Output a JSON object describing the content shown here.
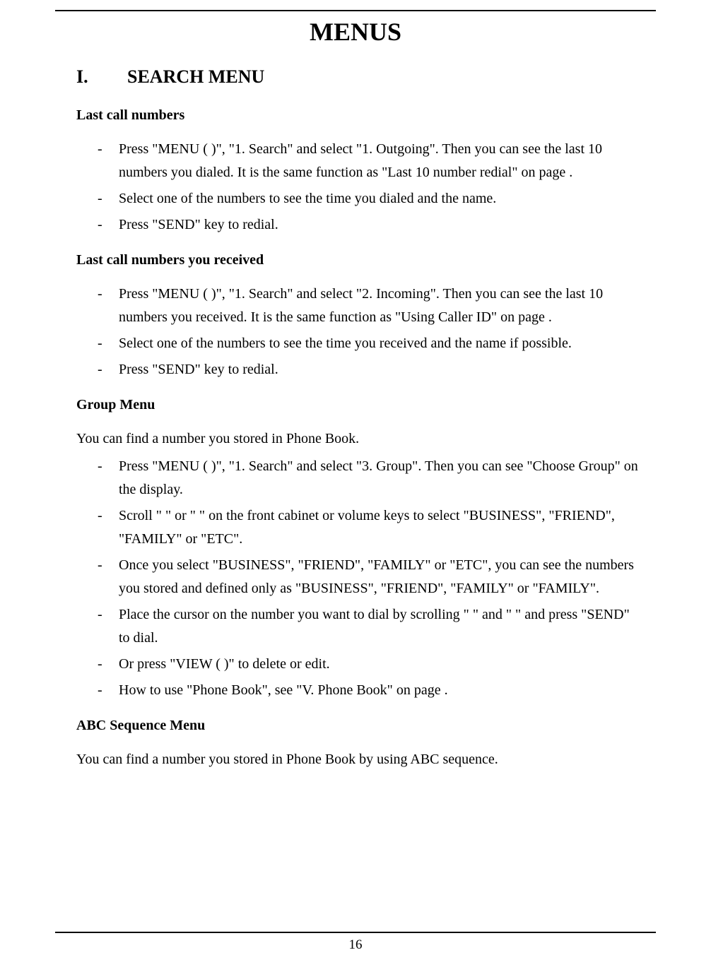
{
  "page_number": "16",
  "title": "MENUS",
  "section": {
    "number": "I.",
    "heading": "SEARCH MENU"
  },
  "subsections": [
    {
      "heading": "Last call numbers",
      "intro": "",
      "items": [
        "Press \"MENU (  )\", \"1. Search\" and select \"1. Outgoing\". Then you can see the last 10 numbers you dialed. It is the same function as \"Last 10 number redial\" on page   .",
        "Select one of the numbers to see the time you dialed and the name.",
        "Press \"SEND\" key to redial."
      ]
    },
    {
      "heading": "Last call numbers you received",
      "intro": "",
      "items": [
        "Press \"MENU (  )\", \"1. Search\" and select \"2. Incoming\". Then you can see the last 10 numbers you received. It is the same function as \"Using Caller ID\" on page   .",
        "Select one of the numbers to see the time you received and the name if possible.",
        "Press \"SEND\" key to redial."
      ]
    },
    {
      "heading": "Group Menu",
      "intro": "You can find a number you stored in Phone Book.",
      "items": [
        "Press \"MENU (  )\", \"1. Search\" and select \"3. Group\". Then you can see \"Choose Group\" on the display.",
        "Scroll \"   \" or \"   \" on the front cabinet or volume keys to select \"BUSINESS\", \"FRIEND\", \"FAMILY\" or \"ETC\".",
        "Once you select \"BUSINESS\", \"FRIEND\", \"FAMILY\" or \"ETC\", you can see the numbers you stored and defined only as \"BUSINESS\", \"FRIEND\", \"FAMILY\" or \"FAMILY\".",
        "Place the cursor on the number you want to dial by scrolling \"   \" and \"   \" and press \"SEND\" to dial.",
        "Or press \"VIEW (  )\" to delete or edit.",
        "How to use \"Phone Book\", see \"V. Phone Book\" on page   ."
      ]
    },
    {
      "heading": "ABC Sequence Menu",
      "intro": "You can find a number you stored in Phone Book by using ABC sequence.",
      "items": []
    }
  ]
}
